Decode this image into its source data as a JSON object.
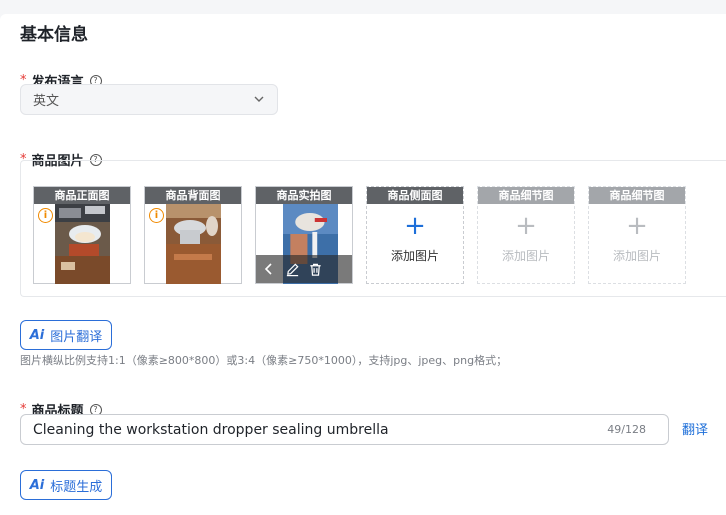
{
  "section": {
    "title": "基本信息"
  },
  "language": {
    "label": "发布语言",
    "required_mark": "*",
    "help": "?",
    "selected": "英文"
  },
  "images": {
    "label": "商品图片",
    "required_mark": "*",
    "help": "?",
    "slots": [
      {
        "tag": "商品正面图",
        "state": "photo",
        "warning": "i"
      },
      {
        "tag": "商品背面图",
        "state": "photo",
        "warning": "i"
      },
      {
        "tag": "商品实拍图",
        "state": "photo-selected"
      },
      {
        "tag": "商品侧面图",
        "state": "add-active",
        "plus": "+",
        "add_label": "添加图片"
      },
      {
        "tag": "商品细节图",
        "state": "add-disabled",
        "plus": "+",
        "add_label": "添加图片"
      },
      {
        "tag": "商品细节图",
        "state": "add-disabled",
        "plus": "+",
        "add_label": "添加图片"
      }
    ],
    "ai_button": {
      "mark": "Ai",
      "label": "图片翻译"
    },
    "hint": "图片横纵比例支持1:1（像素≥800*800）或3:4（像素≥750*1000），支持jpg、jpeg、png格式；"
  },
  "product_title": {
    "label": "商品标题",
    "required_mark": "*",
    "help": "?",
    "value": "Cleaning the workstation dropper sealing umbrella",
    "counter": "49/128",
    "translate_link": "翻译",
    "ai_button": {
      "mark": "Ai",
      "label": "标题生成"
    }
  },
  "colors": {
    "accent": "#2b6ed8",
    "link": "#1e6fd9",
    "required": "#e53935",
    "warning": "#f08a00",
    "tag_dark": "#5f6266",
    "tag_light": "#a3a6aa"
  },
  "icons": {
    "help": "question-circle-icon",
    "select": "chevron-down-icon",
    "warning": "info-circle-icon",
    "add": "plus-icon",
    "overlay": [
      "chevron-left-icon",
      "edit-icon",
      "trash-icon"
    ]
  }
}
